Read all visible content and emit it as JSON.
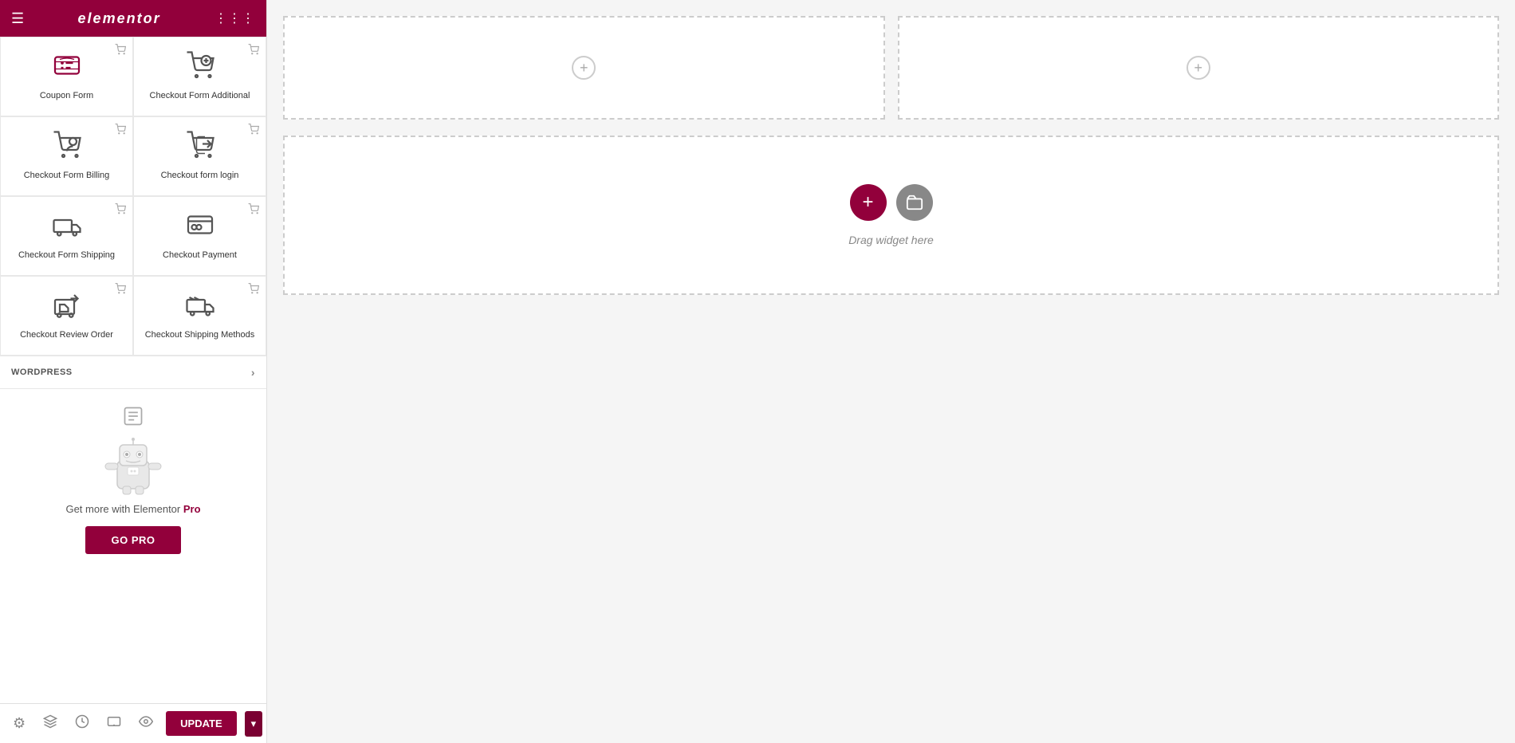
{
  "topbar": {
    "logo": "elementor",
    "menu_icon": "☰",
    "grid_icon": "⋮⋮⋮"
  },
  "widgets": [
    {
      "id": "coupon-form",
      "label": "Coupon Form",
      "icon_type": "coupon",
      "coupon_badge": true
    },
    {
      "id": "checkout-form-additional",
      "label": "Checkout Form Additional",
      "icon_type": "cart-settings",
      "coupon_badge": true
    },
    {
      "id": "checkout-form-billing",
      "label": "Checkout Form Billing",
      "icon_type": "cart-person",
      "coupon_badge": true
    },
    {
      "id": "checkout-form-login",
      "label": "Checkout form login",
      "icon_type": "cart-login",
      "coupon_badge": true
    },
    {
      "id": "checkout-form-shipping",
      "label": "Checkout Form Shipping",
      "icon_type": "cart-truck",
      "coupon_badge": true
    },
    {
      "id": "checkout-payment",
      "label": "Checkout Payment",
      "icon_type": "cart-payment",
      "coupon_badge": true
    },
    {
      "id": "checkout-review-order",
      "label": "Checkout Review Order",
      "icon_type": "cart-review",
      "coupon_badge": true
    },
    {
      "id": "checkout-shipping-methods",
      "label": "Checkout Shipping Methods",
      "icon_type": "cart-shipping",
      "coupon_badge": true
    }
  ],
  "wordpress_section": {
    "label": "WORDPRESS"
  },
  "promo": {
    "text": "Get more with Elementor ",
    "highlight": "Pro",
    "button_label": "GO PRO"
  },
  "bottom_bar": {
    "update_label": "UPDATE"
  },
  "canvas": {
    "drop_zone_label": "Drag widget here",
    "add_section_label": "+"
  }
}
